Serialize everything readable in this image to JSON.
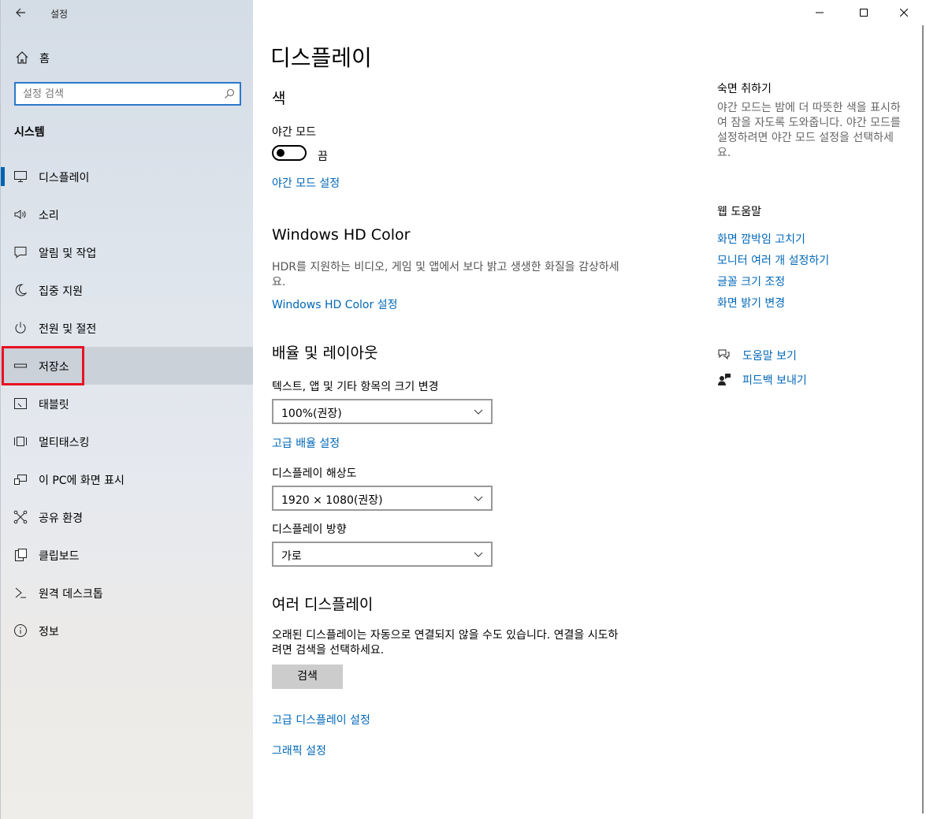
{
  "window": {
    "title": "설정"
  },
  "sidebar": {
    "home_label": "홈",
    "search_placeholder": "설정 검색",
    "section_title": "시스템",
    "items": [
      {
        "label": "디스플레이",
        "icon": "monitor-icon"
      },
      {
        "label": "소리",
        "icon": "speaker-icon"
      },
      {
        "label": "알림 및 작업",
        "icon": "notification-icon"
      },
      {
        "label": "집중 지원",
        "icon": "moon-icon"
      },
      {
        "label": "전원 및 절전",
        "icon": "power-icon"
      },
      {
        "label": "저장소",
        "icon": "storage-icon"
      },
      {
        "label": "태블릿",
        "icon": "tablet-icon"
      },
      {
        "label": "멀티태스킹",
        "icon": "multitasking-icon"
      },
      {
        "label": "이 PC에 화면 표시",
        "icon": "project-icon"
      },
      {
        "label": "공유 환경",
        "icon": "share-icon"
      },
      {
        "label": "클립보드",
        "icon": "clipboard-icon"
      },
      {
        "label": "원격 데스크톱",
        "icon": "remote-desktop-icon"
      },
      {
        "label": "정보",
        "icon": "info-icon"
      }
    ]
  },
  "main": {
    "page_title": "디스플레이",
    "color": {
      "heading": "색",
      "night_mode_label": "야간 모드",
      "toggle_state": "끔",
      "night_mode_settings_link": "야간 모드 설정"
    },
    "hdr": {
      "heading": "Windows HD Color",
      "description": "HDR를 지원하는 비디오, 게임 및 앱에서 보다 밝고 생생한 화질을 감상하세요.",
      "link": "Windows HD Color 설정"
    },
    "scale": {
      "heading": "배율 및 레이아웃",
      "size_label": "텍스트, 앱 및 기타 항목의 크기 변경",
      "size_value": "100%(권장)",
      "advanced_link": "고급 배율 설정",
      "resolution_label": "디스플레이 해상도",
      "resolution_value": "1920 × 1080(권장)",
      "orientation_label": "디스플레이 방향",
      "orientation_value": "가로"
    },
    "multi": {
      "heading": "여러 디스플레이",
      "description": "오래된 디스플레이는 자동으로 연결되지 않을 수도 있습니다. 연결을 시도하려면 검색을 선택하세요.",
      "detect_button": "검색",
      "advanced_display_link": "고급 디스플레이 설정",
      "graphics_link": "그래픽 설정"
    }
  },
  "right": {
    "sleep_heading": "숙면 취하기",
    "sleep_description": "야간 모드는 밤에 더 따뜻한 색을 표시하여 잠을 자도록 도와줍니다. 야간 모드를 설정하려면 야간 모드 설정을 선택하세요.",
    "web_help_heading": "웹 도움말",
    "web_links": [
      "화면 깜박임 고치기",
      "모니터 여러 개 설정하기",
      "글꼴 크기 조정",
      "화면 밝기 변경"
    ],
    "get_help": "도움말 보기",
    "feedback": "피드백 보내기"
  },
  "colors": {
    "accent": "#0067b8",
    "highlight": "#e81123"
  }
}
